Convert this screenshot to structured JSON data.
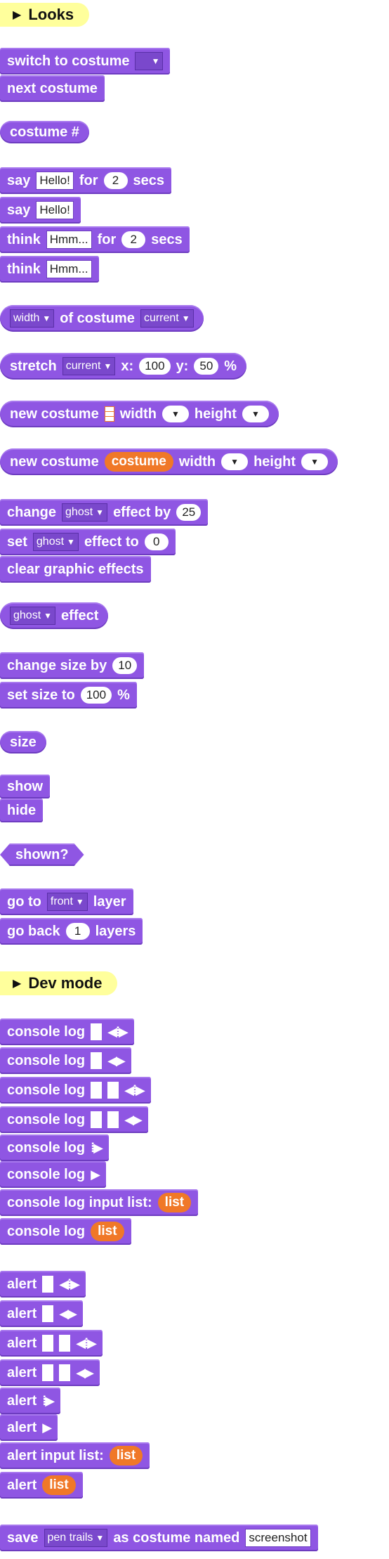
{
  "looks": {
    "header": "Looks",
    "switch_costume": "switch to costume",
    "next_costume": "next costume",
    "costume_num": "costume #",
    "say": "say",
    "for": "for",
    "secs": "secs",
    "hello": "Hello!",
    "two": "2",
    "think": "think",
    "hmm": "Hmm...",
    "width_opt": "width",
    "of_costume": "of costume",
    "current": "current",
    "stretch": "stretch",
    "x_label": "x:",
    "x_val": "100",
    "y_label": "y:",
    "y_val": "50",
    "pct": "%",
    "new_costume": "new costume",
    "width": "width",
    "height": "height",
    "costume_var": "costume",
    "change": "change",
    "ghost": "ghost",
    "effect_by": "effect by",
    "effect_val": "25",
    "set": "set",
    "effect_to": "effect to",
    "zero": "0",
    "clear_effects": "clear graphic effects",
    "effect": "effect",
    "change_size": "change size by",
    "ten": "10",
    "set_size": "set size to",
    "hundred": "100",
    "size": "size",
    "show": "show",
    "hide": "hide",
    "shown": "shown?",
    "go_to": "go to",
    "front": "front",
    "layer": "layer",
    "go_back": "go back",
    "one": "1",
    "layers": "layers"
  },
  "dev": {
    "header": "Dev mode",
    "console_log": "console log",
    "console_log_input_list": "console log input list:",
    "list": "list",
    "alert": "alert",
    "alert_input_list": "alert input list:",
    "save": "save",
    "pen_trails": "pen trails",
    "as_costume_named": "as costume named",
    "screenshot": "screenshot"
  }
}
